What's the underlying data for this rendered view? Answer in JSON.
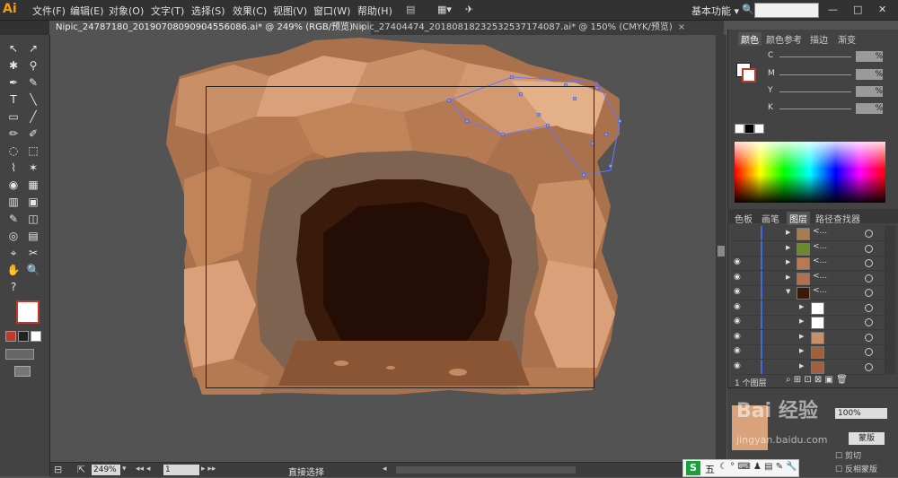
{
  "app": {
    "logo": "Ai",
    "menus": [
      "文件(F)",
      "编辑(E)",
      "对象(O)",
      "文字(T)",
      "选择(S)",
      "效果(C)",
      "视图(V)",
      "窗口(W)",
      "帮助(H)"
    ],
    "workspace_label": "基本功能",
    "workspace_arrow": "▾"
  },
  "tabs": [
    {
      "label": "Nipic_24787180_20190708090904556086.ai* @ 249% (RGB/预览)",
      "close": "×"
    },
    {
      "label": "Nipic_27404474_20180818232532537174087.ai* @ 150% (CMYK/预览)",
      "close": "×"
    }
  ],
  "tools": [
    "↖",
    "↗",
    "✱",
    "⚲",
    "✒",
    "✎",
    "T",
    "╲",
    "▭",
    "╱",
    "✏",
    "✐",
    "◌",
    "⬚",
    "⌇",
    "✶",
    "◉",
    "▦",
    "▥",
    "▣",
    "✎",
    "◫",
    "◎",
    "▤",
    "⌖",
    "✂",
    "✋",
    "🔍",
    "?"
  ],
  "color_panel": {
    "tabs": [
      "颜色",
      "颜色参考",
      "描边",
      "渐变"
    ],
    "sliders": [
      {
        "label": "C",
        "value": "%"
      },
      {
        "label": "M",
        "value": "%"
      },
      {
        "label": "Y",
        "value": "%"
      },
      {
        "label": "K",
        "value": "%"
      }
    ]
  },
  "layers_panel": {
    "tabs": [
      "色板",
      "画笔",
      "图层",
      "路径查找器"
    ],
    "rows": [
      {
        "name": "<...",
        "eye": "",
        "thumb": "#a67c52"
      },
      {
        "name": "<...",
        "eye": "",
        "thumb": "#6b8a2f"
      },
      {
        "name": "<...",
        "eye": "◉",
        "thumb": "#b87a52"
      },
      {
        "name": "<...",
        "eye": "◉",
        "thumb": "#b07050"
      },
      {
        "name": "<...",
        "eye": "◉",
        "thumb": "#3a1a0a"
      },
      {
        "name": "",
        "eye": "◉",
        "thumb": "#ffffff"
      },
      {
        "name": "",
        "eye": "◉",
        "thumb": "#ffffff"
      },
      {
        "name": "",
        "eye": "◉",
        "thumb": "#c8906a"
      },
      {
        "name": "",
        "eye": "◉",
        "thumb": "#a0603a"
      },
      {
        "name": "",
        "eye": "◉",
        "thumb": "#a06040"
      }
    ],
    "footer": "1 个图层",
    "zoom_value": "100%",
    "btn_mask": "蒙版",
    "check_clip": "剪切",
    "check_invert": "反相蒙版"
  },
  "statusbar": {
    "zoom": "249%",
    "page": "1",
    "tool_name": "直接选择"
  },
  "ime": {
    "label": "五"
  },
  "watermark": "jingyan.baidu.com"
}
